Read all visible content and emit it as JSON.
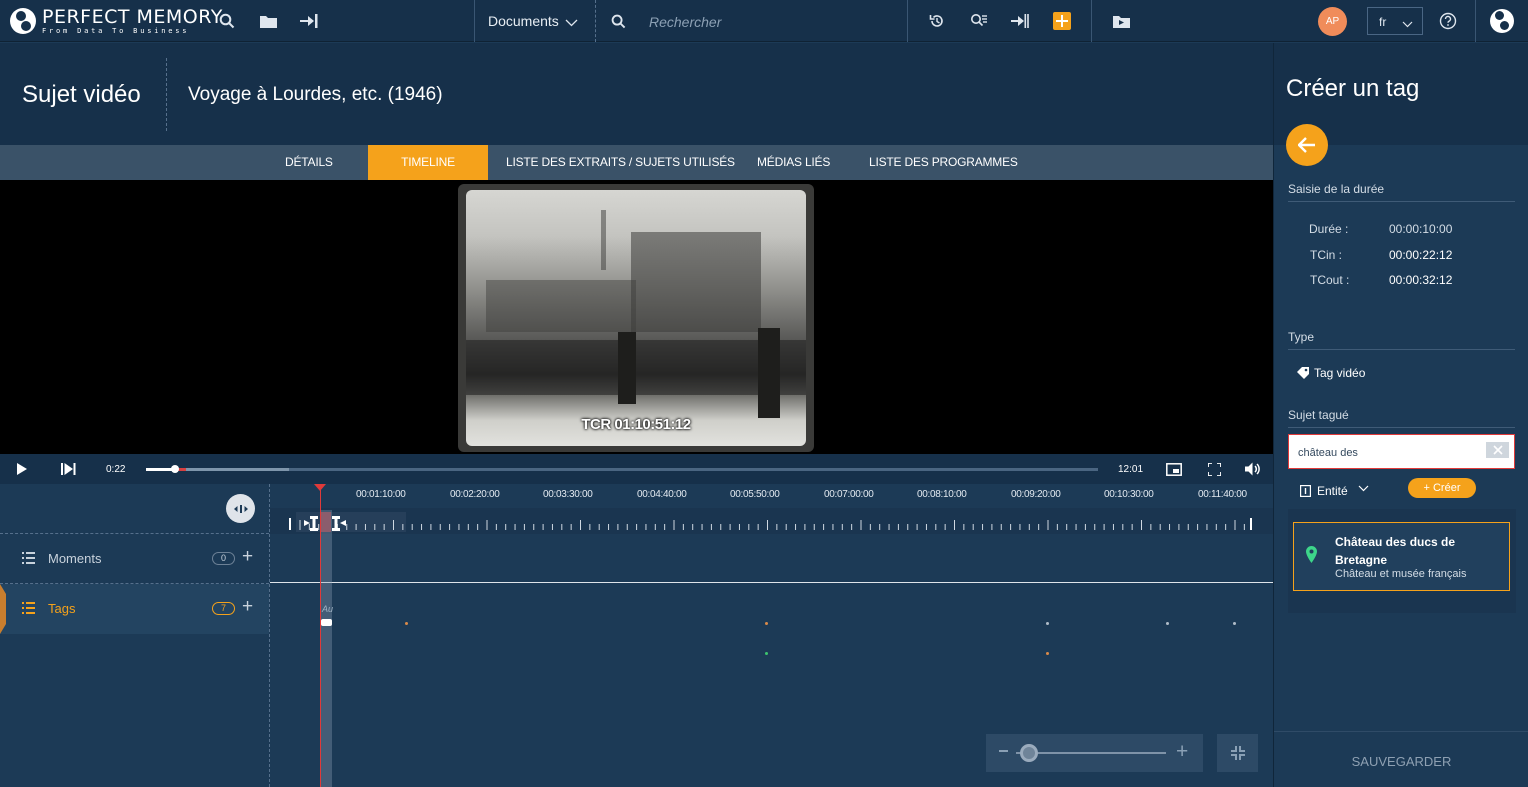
{
  "app": {
    "brand_title": "PERFECT MEMORY",
    "brand_tagline": "From Data To Business"
  },
  "topbar": {
    "documents_label": "Documents",
    "search_placeholder": "Rechercher",
    "avatar_initials": "AP",
    "language": "fr",
    "accent_color": "#f5a21b"
  },
  "header": {
    "entity_type": "Sujet vidéo",
    "title": "Voyage à Lourdes, etc. (1946)"
  },
  "tabs": [
    {
      "label": "DÉTAILS",
      "active": false
    },
    {
      "label": "TIMELINE",
      "active": true
    },
    {
      "label": "LISTE DES EXTRAITS / SUJETS UTILISÉS",
      "active": false
    },
    {
      "label": "MÉDIAS LIÉS",
      "active": false
    },
    {
      "label": "LISTE DES PROGRAMMES",
      "active": false
    }
  ],
  "video": {
    "burned_timecode": "TCR 01:10:51:12"
  },
  "player": {
    "current_time": "0:22",
    "duration": "12:01",
    "played_fraction": 0.03,
    "buffered_fraction": 0.15
  },
  "timeline": {
    "ruler_labels": [
      "00:01:10:00",
      "00:02:20:00",
      "00:03:30:00",
      "00:04:40:00",
      "00:05:50:00",
      "00:07:00:00",
      "00:08:10:00",
      "00:09:20:00",
      "00:10:30:00",
      "00:11:40:00"
    ],
    "tracks": [
      {
        "label": "Moments",
        "count": "0"
      },
      {
        "label": "Tags",
        "count": "7"
      }
    ],
    "tag_marker_text": "Au"
  },
  "panel": {
    "title": "Créer un tag",
    "duration_section": "Saisie de la durée",
    "fields": [
      {
        "label": "Durée :",
        "value": "00:00:10:00"
      },
      {
        "label": "TCin :",
        "value": "00:00:22:12"
      },
      {
        "label": "TCout :",
        "value": "00:00:32:12"
      }
    ],
    "type_section": "Type",
    "type_value": "Tag vidéo",
    "subject_section": "Sujet tagué",
    "search_value": "château des",
    "entity_filter": "Entité",
    "create_label": "Créer",
    "result": {
      "title": "Château des ducs de Bretagne",
      "subtitle": "Château et musée français"
    },
    "save_label": "SAUVEGARDER"
  }
}
